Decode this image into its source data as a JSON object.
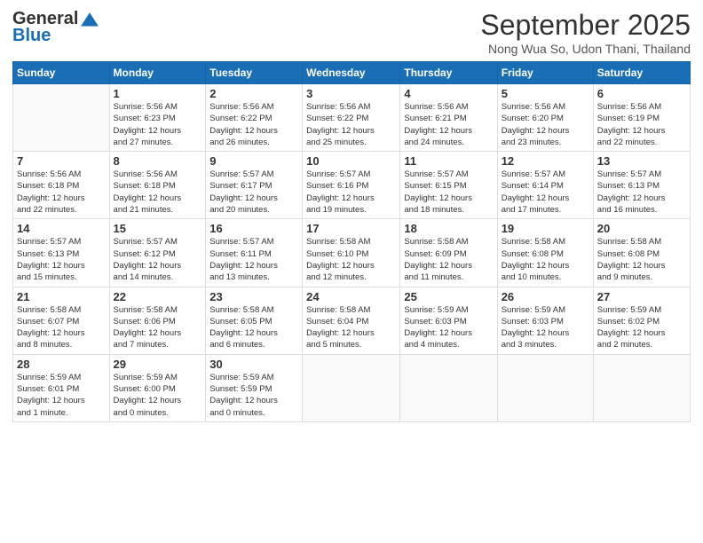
{
  "header": {
    "logo_line1": "General",
    "logo_line2": "Blue",
    "month_title": "September 2025",
    "location": "Nong Wua So, Udon Thani, Thailand"
  },
  "weekdays": [
    "Sunday",
    "Monday",
    "Tuesday",
    "Wednesday",
    "Thursday",
    "Friday",
    "Saturday"
  ],
  "weeks": [
    [
      {
        "day": "",
        "info": ""
      },
      {
        "day": "1",
        "info": "Sunrise: 5:56 AM\nSunset: 6:23 PM\nDaylight: 12 hours\nand 27 minutes."
      },
      {
        "day": "2",
        "info": "Sunrise: 5:56 AM\nSunset: 6:22 PM\nDaylight: 12 hours\nand 26 minutes."
      },
      {
        "day": "3",
        "info": "Sunrise: 5:56 AM\nSunset: 6:22 PM\nDaylight: 12 hours\nand 25 minutes."
      },
      {
        "day": "4",
        "info": "Sunrise: 5:56 AM\nSunset: 6:21 PM\nDaylight: 12 hours\nand 24 minutes."
      },
      {
        "day": "5",
        "info": "Sunrise: 5:56 AM\nSunset: 6:20 PM\nDaylight: 12 hours\nand 23 minutes."
      },
      {
        "day": "6",
        "info": "Sunrise: 5:56 AM\nSunset: 6:19 PM\nDaylight: 12 hours\nand 22 minutes."
      }
    ],
    [
      {
        "day": "7",
        "info": "Sunrise: 5:56 AM\nSunset: 6:18 PM\nDaylight: 12 hours\nand 22 minutes."
      },
      {
        "day": "8",
        "info": "Sunrise: 5:56 AM\nSunset: 6:18 PM\nDaylight: 12 hours\nand 21 minutes."
      },
      {
        "day": "9",
        "info": "Sunrise: 5:57 AM\nSunset: 6:17 PM\nDaylight: 12 hours\nand 20 minutes."
      },
      {
        "day": "10",
        "info": "Sunrise: 5:57 AM\nSunset: 6:16 PM\nDaylight: 12 hours\nand 19 minutes."
      },
      {
        "day": "11",
        "info": "Sunrise: 5:57 AM\nSunset: 6:15 PM\nDaylight: 12 hours\nand 18 minutes."
      },
      {
        "day": "12",
        "info": "Sunrise: 5:57 AM\nSunset: 6:14 PM\nDaylight: 12 hours\nand 17 minutes."
      },
      {
        "day": "13",
        "info": "Sunrise: 5:57 AM\nSunset: 6:13 PM\nDaylight: 12 hours\nand 16 minutes."
      }
    ],
    [
      {
        "day": "14",
        "info": "Sunrise: 5:57 AM\nSunset: 6:13 PM\nDaylight: 12 hours\nand 15 minutes."
      },
      {
        "day": "15",
        "info": "Sunrise: 5:57 AM\nSunset: 6:12 PM\nDaylight: 12 hours\nand 14 minutes."
      },
      {
        "day": "16",
        "info": "Sunrise: 5:57 AM\nSunset: 6:11 PM\nDaylight: 12 hours\nand 13 minutes."
      },
      {
        "day": "17",
        "info": "Sunrise: 5:58 AM\nSunset: 6:10 PM\nDaylight: 12 hours\nand 12 minutes."
      },
      {
        "day": "18",
        "info": "Sunrise: 5:58 AM\nSunset: 6:09 PM\nDaylight: 12 hours\nand 11 minutes."
      },
      {
        "day": "19",
        "info": "Sunrise: 5:58 AM\nSunset: 6:08 PM\nDaylight: 12 hours\nand 10 minutes."
      },
      {
        "day": "20",
        "info": "Sunrise: 5:58 AM\nSunset: 6:08 PM\nDaylight: 12 hours\nand 9 minutes."
      }
    ],
    [
      {
        "day": "21",
        "info": "Sunrise: 5:58 AM\nSunset: 6:07 PM\nDaylight: 12 hours\nand 8 minutes."
      },
      {
        "day": "22",
        "info": "Sunrise: 5:58 AM\nSunset: 6:06 PM\nDaylight: 12 hours\nand 7 minutes."
      },
      {
        "day": "23",
        "info": "Sunrise: 5:58 AM\nSunset: 6:05 PM\nDaylight: 12 hours\nand 6 minutes."
      },
      {
        "day": "24",
        "info": "Sunrise: 5:58 AM\nSunset: 6:04 PM\nDaylight: 12 hours\nand 5 minutes."
      },
      {
        "day": "25",
        "info": "Sunrise: 5:59 AM\nSunset: 6:03 PM\nDaylight: 12 hours\nand 4 minutes."
      },
      {
        "day": "26",
        "info": "Sunrise: 5:59 AM\nSunset: 6:03 PM\nDaylight: 12 hours\nand 3 minutes."
      },
      {
        "day": "27",
        "info": "Sunrise: 5:59 AM\nSunset: 6:02 PM\nDaylight: 12 hours\nand 2 minutes."
      }
    ],
    [
      {
        "day": "28",
        "info": "Sunrise: 5:59 AM\nSunset: 6:01 PM\nDaylight: 12 hours\nand 1 minute."
      },
      {
        "day": "29",
        "info": "Sunrise: 5:59 AM\nSunset: 6:00 PM\nDaylight: 12 hours\nand 0 minutes."
      },
      {
        "day": "30",
        "info": "Sunrise: 5:59 AM\nSunset: 5:59 PM\nDaylight: 12 hours\nand 0 minutes."
      },
      {
        "day": "",
        "info": ""
      },
      {
        "day": "",
        "info": ""
      },
      {
        "day": "",
        "info": ""
      },
      {
        "day": "",
        "info": ""
      }
    ]
  ]
}
